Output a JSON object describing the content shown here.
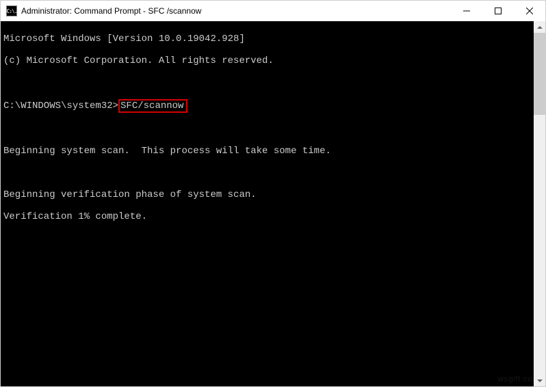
{
  "window": {
    "title": "Administrator: Command Prompt - SFC /scannow",
    "icon_glyph": "C:\\."
  },
  "terminal": {
    "line1": "Microsoft Windows [Version 10.0.19042.928]",
    "line2": "(c) Microsoft Corporation. All rights reserved.",
    "blank1": "",
    "prompt": "C:\\WINDOWS\\system32>",
    "command": "SFC/scannow",
    "blank2": "",
    "line5": "Beginning system scan.  This process will take some time.",
    "blank3": "",
    "line6": "Beginning verification phase of system scan.",
    "line7": "Verification 1% complete."
  },
  "watermark": "wsgift.com"
}
